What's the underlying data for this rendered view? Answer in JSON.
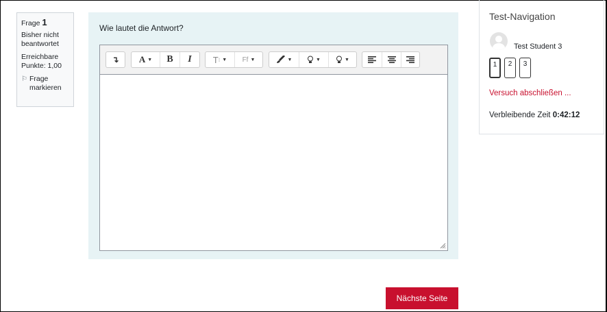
{
  "question_info": {
    "number_label": "Frage",
    "number": "1",
    "state": "Bisher nicht beantwortet",
    "grade": "Erreichbare Punkte: 1,00",
    "flag_label": "Frage markieren"
  },
  "question": {
    "text": "Wie lautet die Antwort?"
  },
  "toolbar": {
    "groups": [
      [
        "expand-toolbar"
      ],
      [
        "font-size-dropdown",
        "bold",
        "italic"
      ],
      [
        "styles-dropdown",
        "font-family-dropdown"
      ],
      [
        "text-color-dropdown",
        "highlight-dropdown",
        "background-color-dropdown"
      ],
      [
        "align-left",
        "align-center",
        "align-right"
      ]
    ],
    "expand_glyph": "↴",
    "fontsize_glyph": "A",
    "bold_glyph": "B",
    "italic_glyph": "I",
    "styles_glyph": "T",
    "fontfamily_glyph": "Ff"
  },
  "editor": {
    "value": ""
  },
  "next_button": "Nächste Seite",
  "navigation": {
    "title": "Test-Navigation",
    "user_name": "Test Student 3",
    "questions": [
      "1",
      "2",
      "3"
    ],
    "current_question": "1",
    "finish_link": "Versuch abschließen ...",
    "time_label": "Verbleibende Zeit",
    "time_value": "0:42:12"
  },
  "colors": {
    "primary": "#c8102e",
    "question_bg": "#e7f3f5"
  }
}
